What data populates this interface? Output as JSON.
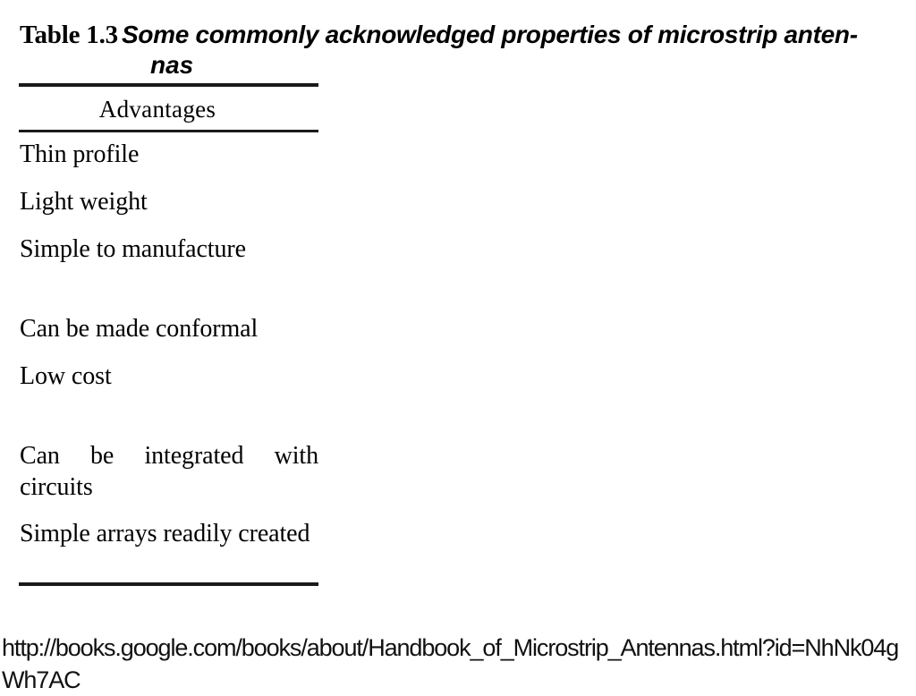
{
  "figure": {
    "caption": {
      "label": "Table 1.3",
      "text": "Some commonly acknowledged properties of microstrip anten-",
      "continuation": "nas"
    },
    "table": {
      "column_header": "Advantages",
      "groups": [
        {
          "rows": [
            "Thin profile",
            "Light weight",
            "Simple to manufacture"
          ]
        },
        {
          "rows": [
            "Can be made conformal",
            "Low cost"
          ]
        },
        {
          "rows": [
            "Can be integrated with circuits",
            "Simple arrays readily created"
          ]
        }
      ]
    }
  },
  "source": {
    "url": "http://books.google.com/books/about/Handbook_of_Microstrip_Antennas.html?id=NhNk04gWh7AC"
  },
  "colors": {
    "background": "#ffffff",
    "text": "#000000",
    "rule": "#1a1a1a"
  }
}
